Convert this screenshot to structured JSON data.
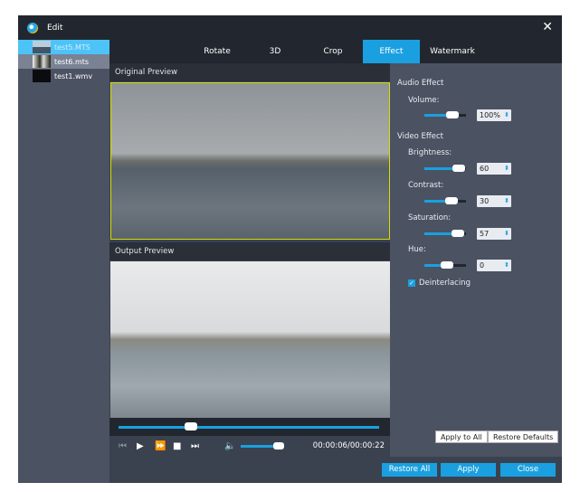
{
  "window": {
    "title": "Edit",
    "close_icon": "close-icon"
  },
  "files": [
    {
      "name": "test5.MTS"
    },
    {
      "name": "test6.mts"
    },
    {
      "name": "test1.wmv"
    }
  ],
  "tabs": [
    "Rotate",
    "3D",
    "Crop",
    "Effect",
    "Watermark"
  ],
  "active_tab": "Effect",
  "preview": {
    "original_label": "Original Preview",
    "output_label": "Output Preview",
    "progress": 0.27,
    "volume": 0.8
  },
  "player": {
    "time": "00:00:06/00:00:22"
  },
  "effects": {
    "audio_title": "Audio Effect",
    "volume_label": "Volume:",
    "volume_value": "100%",
    "video_title": "Video Effect",
    "brightness_label": "Brightness:",
    "brightness_value": "60",
    "contrast_label": "Contrast:",
    "contrast_value": "30",
    "saturation_label": "Saturation:",
    "saturation_value": "57",
    "hue_label": "Hue:",
    "hue_value": "0",
    "deinterlacing_label": "Deinterlacing",
    "deinterlacing_checked": true,
    "apply_all": "Apply to All",
    "restore_defaults": "Restore Defaults"
  },
  "footer": {
    "restore_all": "Restore All",
    "apply": "Apply",
    "close": "Close"
  },
  "colors": {
    "accent": "#1aa0e0"
  }
}
